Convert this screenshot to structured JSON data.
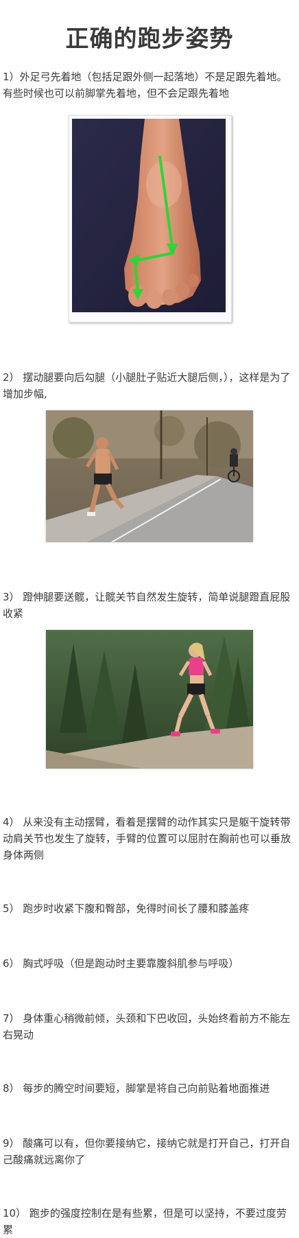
{
  "title": "正确的跑步姿势",
  "paragraphs": [
    "1）外足弓先着地（包括足跟外侧一起落地）不是足跟先着地。有些时候也可以前脚掌先着地，但不会足跟先着地",
    "2） 摆动腿要向后勾腿（小腿肚子贴近大腿后侧，），这样是为了增加步幅,",
    "3） 蹬伸腿要送髋，让髋关节自然发生旋转，简单说腿蹬直屁股收紧",
    "4） 从来没有主动摆臂，看着是摆臂的动作其实只是躯干旋转带动肩关节也发生了旋转，手臂的位置可以屈肘在胸前也可以垂放身体两侧",
    "5） 跑步时收紧下腹和臀部，免得时间长了腰和膝盖疼",
    "6） 胸式呼吸（但是跑动时主要靠腹斜肌参与呼吸）",
    "7） 身体重心稍微前倾，头颈和下巴收回，头始终看前方不能左右晃动",
    "8） 每步的腾空时间要短，脚掌是将自己向前贴着地面推进",
    "9） 酸痛可以有，但你要接纳它，接纳它就是打开自己，打开自己酸痛就远离你了",
    "10） 跑步的强度控制在是有些累，但是可以坚持，不要过度劳累"
  ],
  "colors": {
    "text": "#3a3a3a",
    "arrow": "#2fd33a",
    "shirt_pink": "#e8408a"
  }
}
